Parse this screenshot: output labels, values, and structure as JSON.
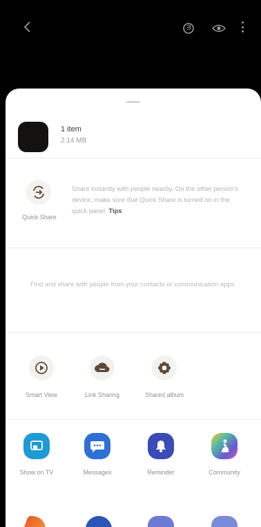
{
  "topbar": {
    "back_icon": "chevron-left-icon",
    "bixby_icon": "bixby-vision-icon",
    "eye_icon": "eye-icon",
    "more_icon": "more-vertical-icon"
  },
  "file": {
    "name": "1 item",
    "size": "2.14 MB"
  },
  "quick_share": {
    "label": "Quick Share",
    "description": "Share instantly with people nearby. On the other person's device, make sure that Quick Share is turned on in the quick panel.",
    "link": "Tips"
  },
  "nearby_text": "Find and share with people from your contacts or communication apps.",
  "actions": [
    {
      "label": "Smart View",
      "icon": "play-circle-icon"
    },
    {
      "label": "Link Sharing",
      "icon": "cloud-link-icon"
    },
    {
      "label": "Shared album",
      "icon": "flower-icon"
    }
  ],
  "apps": [
    {
      "label": "Show on TV",
      "icon": "cast-icon",
      "color": "#1e9ad6"
    },
    {
      "label": "Messages",
      "icon": "chat-bubble-icon",
      "color": "#2f70d6"
    },
    {
      "label": "Reminder",
      "icon": "bell-icon",
      "color": "#3b4bb8"
    },
    {
      "label": "Community",
      "icon": "community-icon",
      "color": "#7c55c9"
    }
  ],
  "colors": {
    "sheet": "#ffffff",
    "background": "#000000",
    "icon_tint": "#5e4a3a"
  }
}
